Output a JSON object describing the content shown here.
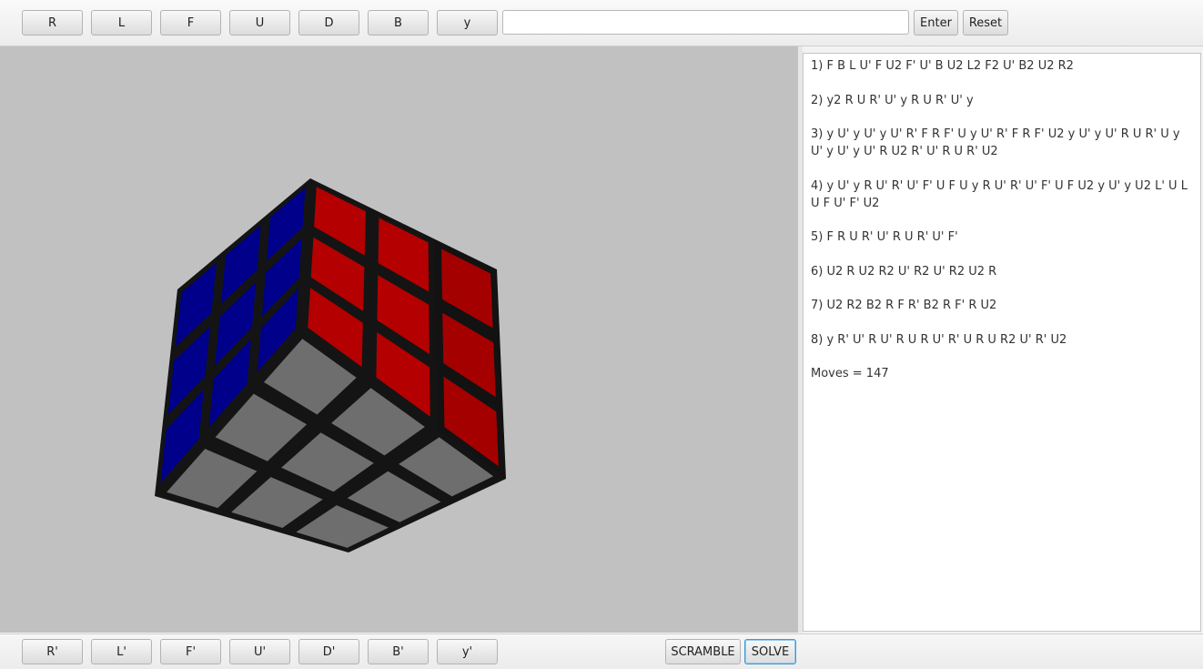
{
  "toolbar_top": {
    "moves": [
      "R",
      "L",
      "F",
      "U",
      "D",
      "B",
      "y"
    ],
    "input_value": "",
    "input_placeholder": "",
    "enter_label": "Enter",
    "reset_label": "Reset"
  },
  "toolbar_bottom": {
    "moves": [
      "R'",
      "L'",
      "F'",
      "U'",
      "D'",
      "B'",
      "y'"
    ],
    "scramble_label": "SCRAMBLE",
    "solve_label": "SOLVE"
  },
  "cube": {
    "colors": {
      "left_face": "#00008b",
      "front_face": "#b40000",
      "bottom_face": "#6e6e6e",
      "gap": "#141414",
      "background": "#c1c1c1"
    }
  },
  "solution": {
    "steps": [
      "1) F B L U' F U2 F' U' B U2 L2 F2 U' B2 U2 R2",
      "2) y2 R U R' U' y R U R' U' y",
      "3) y U' y U' y U' R' F R F' U y U' R' F R F' U2 y U' y U' R U R' U y U' y U' y U' R U2 R' U' R U R' U2",
      "4) y U' y R U' R' U' F' U F U y R U' R' U' F' U F U2 y U' y U2 L' U L U F U' F' U2",
      "5) F R U R' U' R U R' U' F'",
      "6) U2 R U2 R2 U' R2 U' R2 U2 R",
      "7) U2 R2 B2 R F R' B2 R F' R U2",
      "8) y R' U' R U' R U R U' R' U R U R2 U' R' U2"
    ],
    "moves_total": "Moves = 147"
  }
}
